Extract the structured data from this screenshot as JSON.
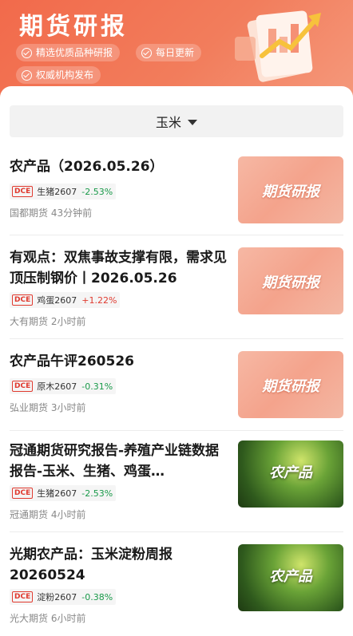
{
  "header": {
    "title": "期货研报",
    "tags": [
      "精选优质品种研报",
      "每日更新",
      "权威机构发布"
    ]
  },
  "filter": {
    "selected": "玉米"
  },
  "colors": {
    "accent": "#f26a4b",
    "up": "#e03a2f",
    "down": "#1a9a4a"
  },
  "items": [
    {
      "title": "农产品（2026.05.26）",
      "exchange": "DCE",
      "contract": "生猪2607",
      "change": "-2.53%",
      "source": "国都期货 43分钟前",
      "thumb": "期货研报"
    },
    {
      "title": "有观点：双焦事故支撑有限，需求见顶压制钢价丨2026.05.26",
      "exchange": "DCE",
      "contract": "鸡蛋2607",
      "change": "+1.22%",
      "source": "大有期货 2小时前",
      "thumb": "期货研报"
    },
    {
      "title": "农产品午评260526",
      "exchange": "DCE",
      "contract": "原木2607",
      "change": "-0.31%",
      "source": "弘业期货 3小时前",
      "thumb": "期货研报"
    },
    {
      "title": "冠通期货研究报告-养殖产业链数据报告-玉米、生猪、鸡蛋…",
      "exchange": "DCE",
      "contract": "生猪2607",
      "change": "-2.53%",
      "source": "冠通期货 4小时前",
      "thumb": "农产品"
    },
    {
      "title": "光期农产品：玉米淀粉周报20260524",
      "exchange": "DCE",
      "contract": "淀粉2607",
      "change": "-0.38%",
      "source": "光大期货 6小时前",
      "thumb": "农产品"
    }
  ]
}
